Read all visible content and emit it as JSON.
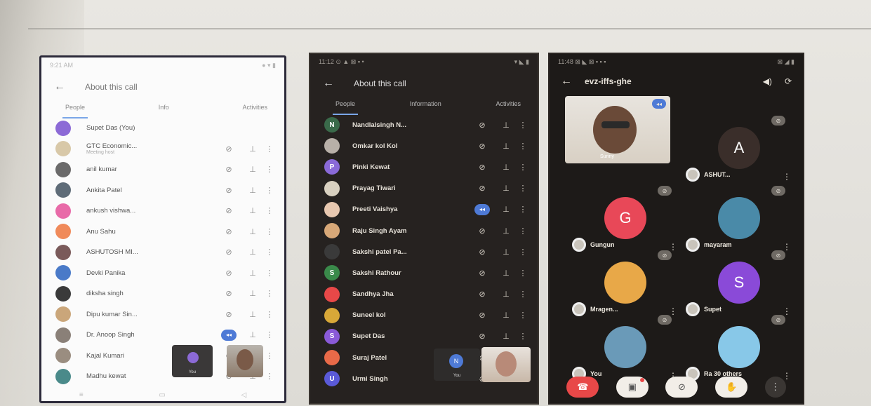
{
  "phone1": {
    "status_left": "9:21 AM",
    "status_right": "● ▾ ▮",
    "title": "About this call",
    "tabs": [
      "People",
      "Info",
      "Activities"
    ],
    "people": [
      {
        "name": "Supet Das (You)",
        "sub": "",
        "color": "#8c6ad6",
        "controls": false
      },
      {
        "name": "GTC Economic...",
        "sub": "Meeting host",
        "color": "#d8c8a8",
        "controls": true
      },
      {
        "name": "anil kumar",
        "sub": "",
        "color": "#6b6a6a",
        "controls": true
      },
      {
        "name": "Ankita Patel",
        "sub": "",
        "color": "#5f6c78",
        "controls": true
      },
      {
        "name": "ankush vishwa...",
        "sub": "",
        "color": "#e86aa8",
        "controls": true
      },
      {
        "name": "Anu Sahu",
        "sub": "",
        "color": "#f08a5a",
        "controls": true
      },
      {
        "name": "ASHUTOSH MI...",
        "sub": "",
        "color": "#7a5a5a",
        "controls": true
      },
      {
        "name": "Devki Panika",
        "sub": "",
        "color": "#4a7ac8",
        "controls": true
      },
      {
        "name": "diksha singh",
        "sub": "",
        "color": "#3a3a3a",
        "controls": true
      },
      {
        "name": "Dipu kumar Sin...",
        "sub": "",
        "color": "#caa67a",
        "controls": true
      },
      {
        "name": "Dr. Anoop Singh",
        "sub": "",
        "color": "#8a8078",
        "controls": true,
        "speaking": true
      },
      {
        "name": "Kajal Kumari",
        "sub": "",
        "color": "#9a8d80",
        "controls": true
      },
      {
        "name": "Madhu kewat",
        "sub": "",
        "color": "#4a8a8a",
        "controls": true
      }
    ],
    "pip_self_label": "You"
  },
  "phone2": {
    "status_left": "11:12 ⊙ ▲ ⊠ ▪ •",
    "status_right": "▾ ◣ ▮",
    "title": "About this call",
    "tabs": [
      "People",
      "Information",
      "Activities"
    ],
    "people": [
      {
        "name": "Nandlalsingh N...",
        "initial": "N",
        "color": "#3a6a4a"
      },
      {
        "name": "Omkar kol Kol",
        "initial": "",
        "color": "#b8b0a8"
      },
      {
        "name": "Pinki Kewat",
        "initial": "P",
        "color": "#8a6ad8"
      },
      {
        "name": "Prayag Tiwari",
        "initial": "",
        "color": "#d8d0c0"
      },
      {
        "name": "Preeti Vaishya",
        "initial": "",
        "color": "#e8c8b0",
        "speaking": true
      },
      {
        "name": "Raju Singh Ayam",
        "initial": "",
        "color": "#d8a878"
      },
      {
        "name": "Sakshi patel Pa...",
        "initial": "",
        "color": "#3a3a3a"
      },
      {
        "name": "Sakshi Rathour",
        "initial": "S",
        "color": "#3a8a4a"
      },
      {
        "name": "Sandhya Jha",
        "initial": "",
        "color": "#e84848"
      },
      {
        "name": "Suneel kol",
        "initial": "",
        "color": "#d8a838"
      },
      {
        "name": "Supet Das",
        "initial": "S",
        "color": "#8a5ad8"
      },
      {
        "name": "Suraj Patel",
        "initial": "",
        "color": "#e86a48"
      },
      {
        "name": "Urmi Singh",
        "initial": "U",
        "color": "#5a5ad8"
      }
    ],
    "pip_self_initial": "N",
    "pip_self_label": "You"
  },
  "phone3": {
    "status_left": "11:48 ⊠ ◣ ⊠ ▪ ▪ ▪",
    "status_right": "⊠ ◢ ▮",
    "meeting_code": "evz-iffs-ghe",
    "tiles": [
      {
        "name": "ASHUT...",
        "initial": "A",
        "color": "#3a2e2a"
      },
      {
        "name": "Gungun",
        "initial": "G",
        "color": "#e84858"
      },
      {
        "name": "mayaram",
        "initial": "",
        "color": "#4a8aa8"
      },
      {
        "name": "Mragen...",
        "initial": "",
        "color": "#e8a848"
      },
      {
        "name": "Supet",
        "initial": "S",
        "color": "#8a4ad8"
      },
      {
        "name": "You",
        "initial": "",
        "color": "#6a9ab8"
      },
      {
        "name": "Ra   30 others",
        "initial": "",
        "color": "#88c8e8"
      }
    ],
    "presenter_label": "Sunny"
  }
}
